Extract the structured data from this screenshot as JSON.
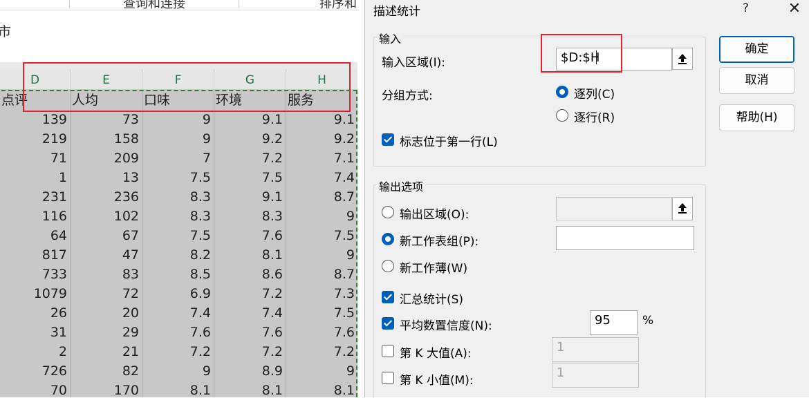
{
  "ribbon": {
    "item1": "查询和连接",
    "item2": "排序和筛选"
  },
  "formula": {
    "text": "市"
  },
  "sheet": {
    "columns": [
      "D",
      "E",
      "F",
      "G",
      "H"
    ],
    "headers": [
      "点评",
      "人均",
      "口味",
      "环境",
      "服务"
    ],
    "rows": [
      [
        "139",
        "73",
        "9",
        "9.1",
        "9.1"
      ],
      [
        "219",
        "158",
        "9",
        "9.2",
        "9.2"
      ],
      [
        "71",
        "209",
        "7",
        "7.2",
        "7.1"
      ],
      [
        "1",
        "13",
        "7.5",
        "7.5",
        "7.4"
      ],
      [
        "231",
        "236",
        "8.3",
        "9.1",
        "8.7"
      ],
      [
        "116",
        "102",
        "8.3",
        "8.3",
        "9"
      ],
      [
        "64",
        "67",
        "7.5",
        "7.6",
        "7.5"
      ],
      [
        "817",
        "47",
        "8.2",
        "8.1",
        "9"
      ],
      [
        "733",
        "83",
        "8.5",
        "8.6",
        "8.7"
      ],
      [
        "1079",
        "72",
        "6.9",
        "7.2",
        "7.3"
      ],
      [
        "26",
        "20",
        "7.4",
        "7.4",
        "7.5"
      ],
      [
        "31",
        "29",
        "7.6",
        "7.6",
        "7.6"
      ],
      [
        "2",
        "21",
        "7.2",
        "7.2",
        "7.2"
      ],
      [
        "726",
        "82",
        "9",
        "8.9",
        "9"
      ],
      [
        "70",
        "170",
        "8.1",
        "8.1",
        "8.1"
      ]
    ]
  },
  "dialog": {
    "title": "描述统计",
    "help": "?",
    "close": "✕",
    "input_group": {
      "title": "输入",
      "range_label": "输入区域(I):",
      "range_value": "$D:$H",
      "group_by_label": "分组方式:",
      "by_column": "逐列(C)",
      "by_row": "逐行(R)",
      "by_column_checked": true,
      "labels_first_row": "标志位于第一行(L)",
      "labels_first_row_checked": true
    },
    "output_group": {
      "title": "输出选项",
      "output_range": "输出区域(O):",
      "new_sheet": "新工作表组(P):",
      "new_workbook": "新工作薄(W)",
      "selected": "new_sheet",
      "summary": "汇总统计(S)",
      "summary_checked": true,
      "confidence": "平均数置信度(N):",
      "confidence_checked": true,
      "confidence_value": "95",
      "percent": "%",
      "kth_largest": "第 K 大值(A):",
      "kth_largest_checked": false,
      "kth_largest_value": "1",
      "kth_smallest": "第 K 小值(M):",
      "kth_smallest_checked": false,
      "kth_smallest_value": "1"
    },
    "buttons": {
      "ok": "确定",
      "cancel": "取消",
      "help": "帮助(H)"
    }
  },
  "colors": {
    "accent": "#005fb8",
    "highlight": "#e8202a",
    "column_letter": "#217346",
    "selection_fill": "#c8c8c8"
  }
}
